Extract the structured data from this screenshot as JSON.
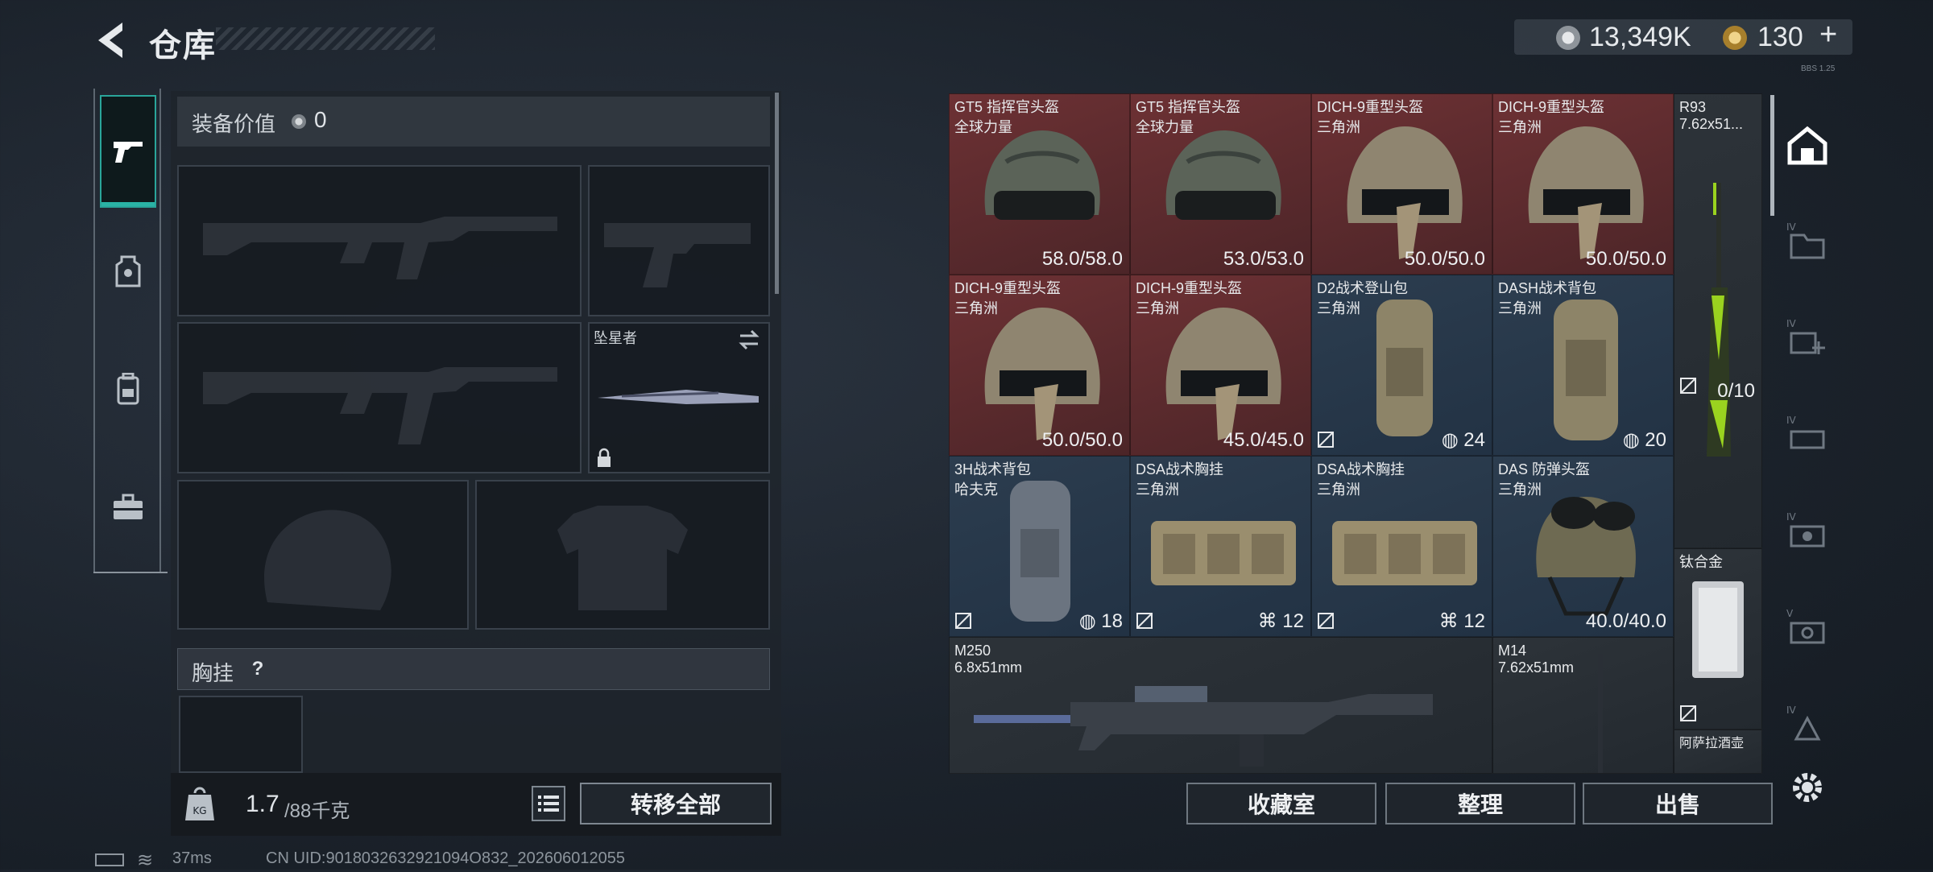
{
  "header": {
    "title": "仓库",
    "money": "13,349K",
    "tokens": "130",
    "tokens_plus": "+",
    "version": "BBS 1.25"
  },
  "loadout": {
    "value_label": "装备价值",
    "value": "0",
    "knife_name": "坠星者",
    "chest_label": "胸挂",
    "chest_help": "?",
    "weight": "1.7",
    "weight_max": "/88千克",
    "transfer_all": "转移全部"
  },
  "storage": {
    "items": [
      {
        "name": "GT5 指挥官头盔",
        "sub": "全球力量",
        "value": "58.0/58.0",
        "color": "red"
      },
      {
        "name": "GT5 指挥官头盔",
        "sub": "全球力量",
        "value": "53.0/53.0",
        "color": "red"
      },
      {
        "name": "DICH-9重型头盔",
        "sub": "三角洲",
        "value": "50.0/50.0",
        "color": "red"
      },
      {
        "name": "DICH-9重型头盔",
        "sub": "三角洲",
        "value": "50.0/50.0",
        "color": "red"
      },
      {
        "name": "R93",
        "sub": "7.62x51...",
        "value": "0/10",
        "color": "gray"
      },
      {
        "name": "DICH-9重型头盔",
        "sub": "三角洲",
        "value": "50.0/50.0",
        "color": "red"
      },
      {
        "name": "DICH-9重型头盔",
        "sub": "三角洲",
        "value": "45.0/45.0",
        "color": "red"
      },
      {
        "name": "D2战术登山包",
        "sub": "三角洲",
        "value": "24",
        "color": "blue"
      },
      {
        "name": "DASH战术背包",
        "sub": "三角洲",
        "value": "20",
        "color": "blue"
      },
      {
        "name": "3H战术背包",
        "sub": "哈夫克",
        "value": "18",
        "color": "blue"
      },
      {
        "name": "DSA战术胸挂",
        "sub": "三角洲",
        "value": "12",
        "color": "blue"
      },
      {
        "name": "DSA战术胸挂",
        "sub": "三角洲",
        "value": "12",
        "color": "blue"
      },
      {
        "name": "DAS 防弹头盔",
        "sub": "三角洲",
        "value": "40.0/40.0",
        "color": "blue"
      },
      {
        "name": "钛合金",
        "sub": "",
        "value": "",
        "color": "gray"
      },
      {
        "name": "M250",
        "sub": "6.8x51mm",
        "value": "",
        "color": "gray"
      },
      {
        "name": "M14",
        "sub": "7.62x51mm",
        "value": "",
        "color": "gray"
      },
      {
        "name": "阿萨拉酒壶",
        "sub": "",
        "value": "",
        "color": "gray"
      }
    ],
    "actions": [
      "收藏室",
      "整理",
      "出售"
    ]
  },
  "status": {
    "ping": "37ms",
    "uid": "CN UID:9018032632921094O832_202606012055"
  },
  "colors": {
    "accent": "#2ab3a5",
    "rare_red": "#6d3134",
    "rare_blue": "#2c3d4f"
  }
}
